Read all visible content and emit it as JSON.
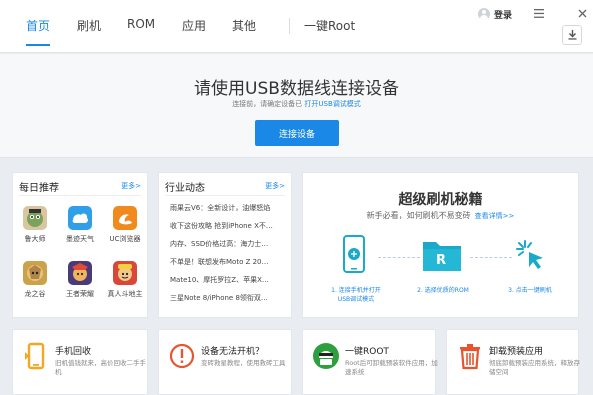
{
  "nav": {
    "tabs": [
      {
        "label": "首页",
        "active": true
      },
      {
        "label": "刷机"
      },
      {
        "label": "ROM"
      },
      {
        "label": "应用"
      },
      {
        "label": "其他"
      },
      {
        "label": "一键Root"
      }
    ],
    "login_label": "登录",
    "menu_icon": "hamburger-icon",
    "close_icon": "close-icon",
    "download_icon": "download-icon"
  },
  "banner": {
    "title": "请使用USB数据线连接设备",
    "subtitle_prefix": "连接前，请确定设备已",
    "subtitle_link": "打开USB调试模式",
    "connect_button": "连接设备"
  },
  "daily": {
    "title": "每日推荐",
    "more": "更多>",
    "apps": [
      {
        "label": "鲁大师",
        "icon": "ludashi-icon"
      },
      {
        "label": "墨迹天气",
        "icon": "moji-weather-icon"
      },
      {
        "label": "UC浏览器",
        "icon": "uc-browser-icon"
      },
      {
        "label": "龙之谷",
        "icon": "dragon-nest-icon"
      },
      {
        "label": "王者荣耀",
        "icon": "honor-of-kings-icon"
      },
      {
        "label": "真人斗地主",
        "icon": "doudizhu-icon"
      }
    ]
  },
  "news": {
    "title": "行业动态",
    "more": "更多>",
    "items": [
      "雨果云V6：全新设计，油爆怒焰",
      "收下这份攻略 抢到iPhone X不…",
      "内存、SSD价格过高：海力士…",
      "不单是！联想发布Moto Z 20…",
      "Mate10、摩托罗拉Z、苹果X…",
      "三星Note 8/iPhone 8领衔双…"
    ]
  },
  "secrets": {
    "title": "超级刷机秘籍",
    "subtitle": "新手必看，如何刷机不易变砖",
    "details_link": "查看详情>>",
    "steps": [
      {
        "caption_line1": "1. 连接手机并打开",
        "caption_line2": "USB调试模式",
        "icon": "phone-usb-icon"
      },
      {
        "caption_line1": "2. 选择优质的ROM",
        "caption_line2": "",
        "icon": "rom-folder-icon"
      },
      {
        "caption_line1": "3. 点击一键刷机",
        "caption_line2": "",
        "icon": "click-flash-icon"
      }
    ],
    "rom_letter": "R"
  },
  "tools": [
    {
      "title": "手机回收",
      "desc": "旧机值钱就来，高价回收二手手机",
      "icon": "phone-recycle-icon",
      "color": "#f5a623"
    },
    {
      "title": "设备无法开机？",
      "desc": "变砖救星教程，使用救砖工具",
      "icon": "warning-icon",
      "color": "#e8542f"
    },
    {
      "title": "一键ROOT",
      "desc": "Root后可卸载预装软件应用，加速系统",
      "icon": "root-android-icon",
      "color": "#2e9f3f"
    },
    {
      "title": "卸载预装应用",
      "desc": "彻底卸载预装应用系统，释放存储空间",
      "icon": "trash-icon",
      "color": "#e8542f"
    }
  ],
  "colors": {
    "accent": "#1a88e6",
    "background": "#e9ecf0",
    "panel": "#ffffff"
  }
}
